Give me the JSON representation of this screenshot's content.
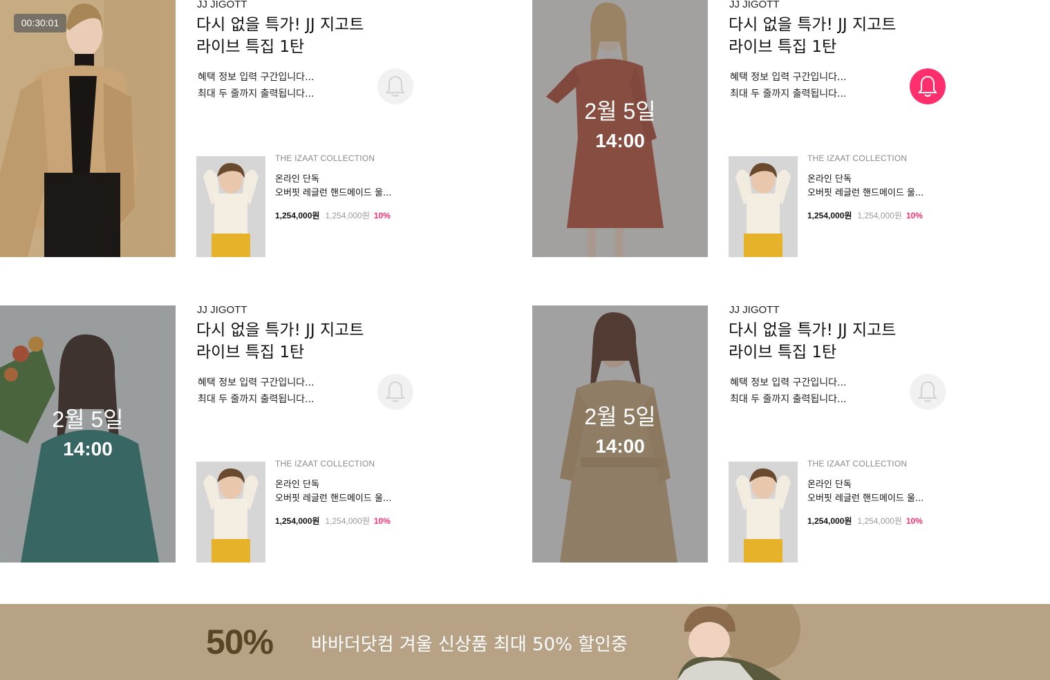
{
  "colors": {
    "accent": "#ff2f6e",
    "banner_bg": "#b8a286",
    "banner_pct": "#5a4426"
  },
  "cards": [
    {
      "timer": "00:30:01",
      "brand": "JJ JIGOTT",
      "title1": "다시 없을 특가! JJ 지고트",
      "title2": "라이브 특집 1탄",
      "benefit1": "혜택 정보 입력 구간입니다...",
      "benefit2": "최대 두 줄까지 출력됩니다...",
      "bell_icon": "bell-icon",
      "bell_active": false,
      "product": {
        "brand": "THE IZAAT COLLECTION",
        "name1": "온라인 단독",
        "name2": "오버핏 레글런 핸드메이드 울...",
        "price": "1,254,000원",
        "original_price": "1,254,000원",
        "discount": "10%"
      }
    },
    {
      "date": "2월 5일",
      "time": "14:00",
      "brand": "JJ JIGOTT",
      "title1": "다시 없을 특가! JJ 지고트",
      "title2": "라이브 특집 1탄",
      "benefit1": "혜택 정보 입력 구간입니다...",
      "benefit2": "최대 두 줄까지 출력됩니다...",
      "bell_icon": "bell-icon",
      "bell_active": true,
      "product": {
        "brand": "THE IZAAT COLLECTION",
        "name1": "온라인 단독",
        "name2": "오버핏 레글런 핸드메이드 울...",
        "price": "1,254,000원",
        "original_price": "1,254,000원",
        "discount": "10%"
      }
    },
    {
      "date": "2월 5일",
      "time": "14:00",
      "brand": "JJ JIGOTT",
      "title1": "다시 없을 특가! JJ 지고트",
      "title2": "라이브 특집 1탄",
      "benefit1": "혜택 정보 입력 구간입니다...",
      "benefit2": "최대 두 줄까지 출력됩니다...",
      "bell_icon": "bell-icon",
      "bell_active": false,
      "product": {
        "brand": "THE IZAAT COLLECTION",
        "name1": "온라인 단독",
        "name2": "오버핏 레글런 핸드메이드 울...",
        "price": "1,254,000원",
        "original_price": "1,254,000원",
        "discount": "10%"
      }
    },
    {
      "date": "2월 5일",
      "time": "14:00",
      "brand": "JJ JIGOTT",
      "title1": "다시 없을 특가! JJ 지고트",
      "title2": "라이브 특집 1탄",
      "benefit1": "혜택 정보 입력 구간입니다...",
      "benefit2": "최대 두 줄까지 출력됩니다...",
      "bell_icon": "bell-icon",
      "bell_active": false,
      "product": {
        "brand": "THE IZAAT COLLECTION",
        "name1": "온라인 단독",
        "name2": "오버핏 레글런 핸드메이드 울...",
        "price": "1,254,000원",
        "original_price": "1,254,000원",
        "discount": "10%"
      }
    }
  ],
  "banner": {
    "percent": "50%",
    "text": "바바더닷컴 겨울 신상품 최대 50% 할인중"
  }
}
